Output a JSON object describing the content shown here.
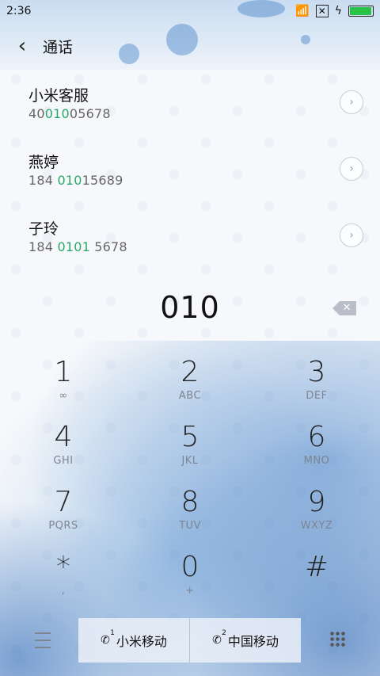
{
  "status_bar": {
    "time": "2:36"
  },
  "header": {
    "title": "通话"
  },
  "contacts": [
    {
      "name": "小米客服",
      "number_pre": "40",
      "number_match": "010",
      "number_post": "05678"
    },
    {
      "name": "燕婷",
      "number_pre": "184 ",
      "number_match": "010",
      "number_post": "15689"
    },
    {
      "name": "子玲",
      "number_pre": "184 ",
      "number_match": "0101",
      "number_post": " 5678"
    }
  ],
  "dialed_number": "010",
  "keypad": [
    {
      "digit": "1",
      "letters": ""
    },
    {
      "digit": "2",
      "letters": "ABC"
    },
    {
      "digit": "3",
      "letters": "DEF"
    },
    {
      "digit": "4",
      "letters": "GHI"
    },
    {
      "digit": "5",
      "letters": "JKL"
    },
    {
      "digit": "6",
      "letters": "MNO"
    },
    {
      "digit": "7",
      "letters": "PQRS"
    },
    {
      "digit": "8",
      "letters": "TUV"
    },
    {
      "digit": "9",
      "letters": "WXYZ"
    },
    {
      "digit": "*",
      "letters": ","
    },
    {
      "digit": "0",
      "letters": "+"
    },
    {
      "digit": "#",
      "letters": ""
    }
  ],
  "bottom_bar": {
    "sim1": {
      "label": "小米移动",
      "sim_number": "1"
    },
    "sim2": {
      "label": "中国移动",
      "sim_number": "2"
    }
  },
  "colors": {
    "match_highlight": "#2ca86a",
    "battery": "#2bc24a"
  }
}
